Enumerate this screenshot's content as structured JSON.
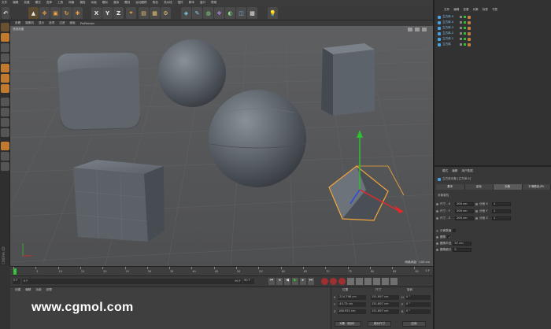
{
  "menubar": {
    "items": [
      "文件",
      "编辑",
      "创建",
      "模式",
      "选择",
      "工具",
      "网格",
      "捕捉",
      "动画",
      "模拟",
      "渲染",
      "雕刻",
      "运动跟踪",
      "角色",
      "流水线",
      "插件",
      "脚本",
      "窗口",
      "帮助"
    ]
  },
  "toolbar": {
    "axis_labels": [
      "X",
      "Y",
      "Z"
    ]
  },
  "viewport": {
    "menu": [
      "查看",
      "摄像机",
      "显示",
      "选项",
      "过滤",
      "面板",
      "ProRender"
    ],
    "label": "透视视图",
    "grid_info": "网格间距：100 cm"
  },
  "objects": {
    "menu": [
      "文件",
      "编辑",
      "查看",
      "对象",
      "标签",
      "书签"
    ],
    "items": [
      "立方体.5",
      "立方体.4",
      "立方体.3",
      "立方体.2",
      "立方体.1",
      "立方体"
    ]
  },
  "attributes": {
    "menu": [
      "模式",
      "编辑",
      "用户数据"
    ],
    "header": "立方体对象 [立方体.5]",
    "tabs": [
      "基本",
      "坐标",
      "对象",
      "平滑着色(Ph"
    ],
    "section": "对象属性",
    "size": [
      {
        "label": "尺寸 . X",
        "value": "200 cm"
      },
      {
        "label": "尺寸 . Y",
        "value": "200 cm"
      },
      {
        "label": "尺寸 . Z",
        "value": "200 cm"
      }
    ],
    "seg": [
      {
        "label": "分段 X",
        "value": "1"
      },
      {
        "label": "分段 Y",
        "value": "1"
      },
      {
        "label": "分段 Z",
        "value": "1"
      }
    ],
    "sep_label": "分离表面",
    "fillet_label": "圆角",
    "radius_label": "圆角半径",
    "radius_value": "97 cm",
    "sub_label": "圆角细分",
    "sub_value": "5"
  },
  "timeline": {
    "ticks": [
      "0",
      "5",
      "10",
      "15",
      "20",
      "25",
      "30",
      "35",
      "40",
      "45",
      "50",
      "55",
      "60",
      "65",
      "70",
      "75",
      "80",
      "85",
      "90"
    ],
    "end": "0 F"
  },
  "transport": {
    "start": "0 F",
    "current": "0 F",
    "end": "90 F",
    "end2": "90 F"
  },
  "materials": {
    "menu": [
      "创建",
      "编辑",
      "功能",
      "纹理"
    ]
  },
  "coords": {
    "headers": [
      "位置",
      "尺寸",
      "旋转"
    ],
    "rows": [
      {
        "axis": "X",
        "pos": "-214.798 cm",
        "size": "151.897 cm",
        "rlabel": "H",
        "rot": "0 °"
      },
      {
        "axis": "Y",
        "pos": "-45.73 cm",
        "size": "151.897 cm",
        "rlabel": "P",
        "rot": "0 °"
      },
      {
        "axis": "Z",
        "pos": "168.952 cm",
        "size": "151.897 cm",
        "rlabel": "B",
        "rot": "0 °"
      }
    ],
    "mode": "对象（相对）",
    "size_mode": "绝对尺寸",
    "apply": "应用"
  },
  "watermark": "www.cgmol.com",
  "brand": "CINEMA 4D"
}
